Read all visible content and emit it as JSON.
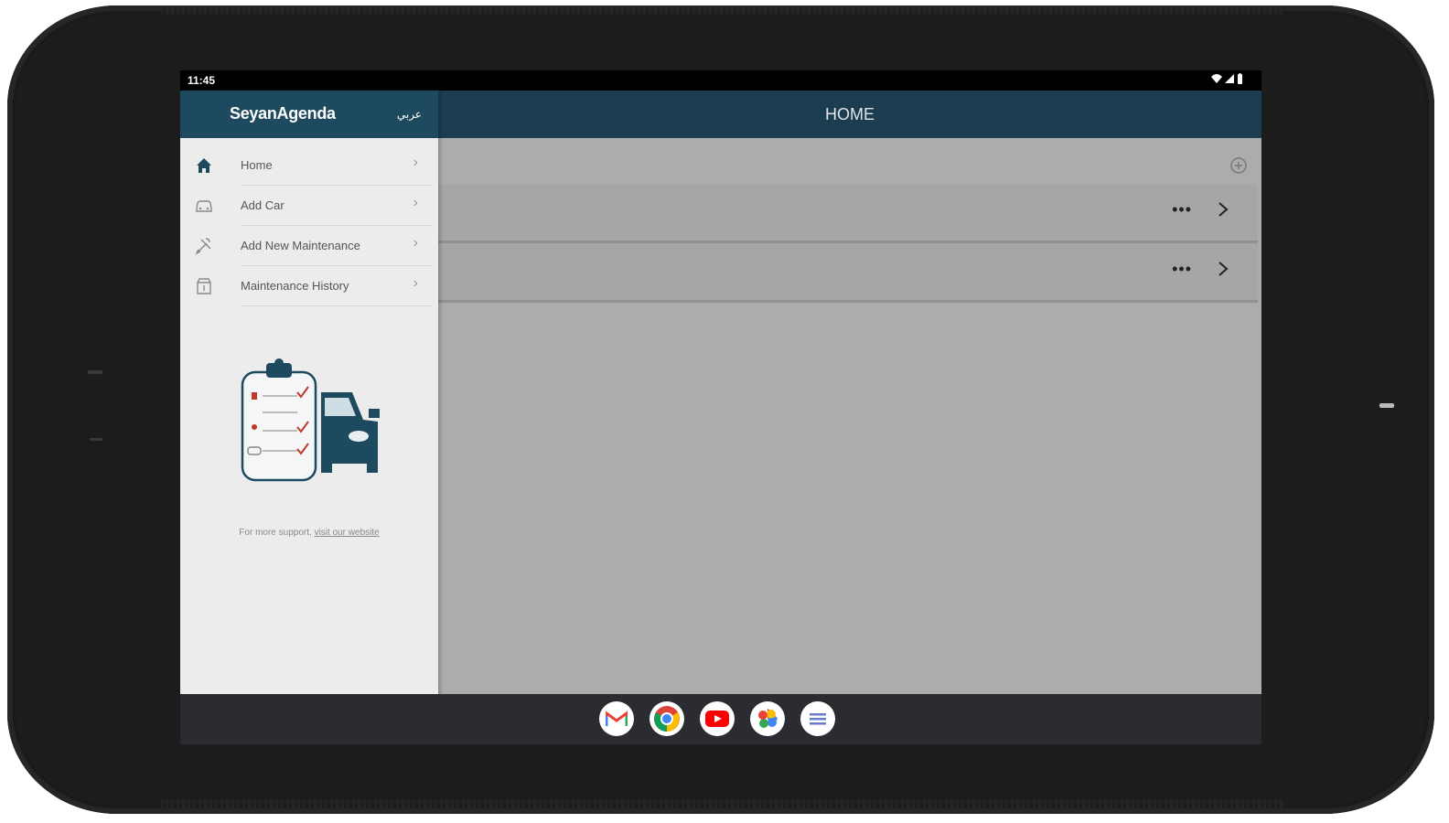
{
  "status_bar": {
    "time": "11:45"
  },
  "drawer": {
    "app_name": "SeyanAgenda",
    "language_toggle": "عربي",
    "menu": [
      {
        "label": "Home",
        "icon": "home-icon"
      },
      {
        "label": "Add Car",
        "icon": "car-icon"
      },
      {
        "label": "Add New Maintenance",
        "icon": "tools-icon"
      },
      {
        "label": "Maintenance History",
        "icon": "history-icon"
      }
    ],
    "support_text": "For more support, ",
    "support_link": "visit our website"
  },
  "header": {
    "title": "HOME"
  },
  "list": {
    "rows": [
      {
        "more": "•••"
      },
      {
        "more": "•••"
      }
    ]
  },
  "colors": {
    "drawer_header": "#1e4a60",
    "topbar": "#1c3d50",
    "content_bg": "#acacac"
  },
  "dock_apps": [
    "gmail-icon",
    "chrome-icon",
    "youtube-icon",
    "photos-icon",
    "app-drawer-icon"
  ]
}
